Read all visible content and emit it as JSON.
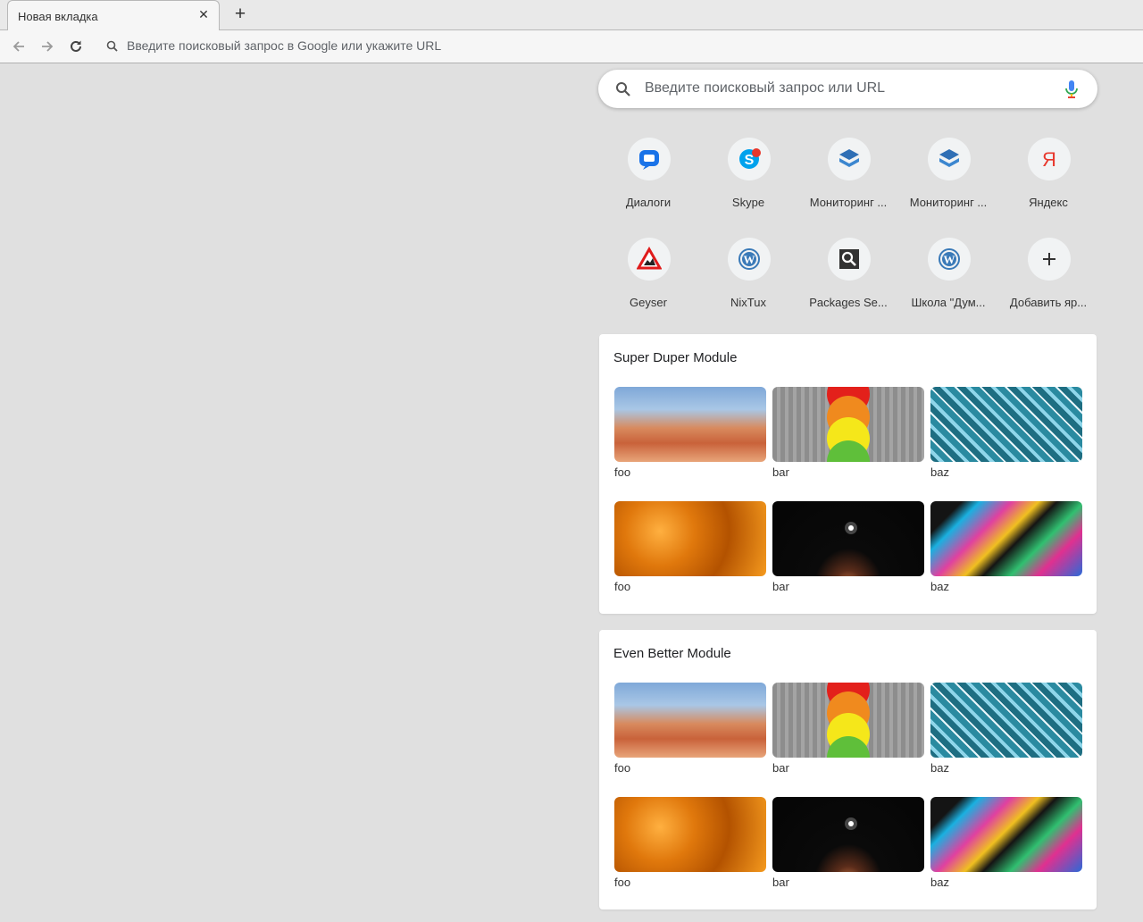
{
  "tab": {
    "title": "Новая вкладка"
  },
  "omnibox": {
    "placeholder": "Введите поисковый запрос в Google или укажите URL"
  },
  "search": {
    "placeholder": "Введите поисковый запрос или URL"
  },
  "shortcuts": [
    {
      "label": "Диалоги",
      "icon": "messages-icon"
    },
    {
      "label": "Skype",
      "icon": "skype-icon"
    },
    {
      "label": "Мониторинг ...",
      "icon": "layers-icon"
    },
    {
      "label": "Мониторинг ...",
      "icon": "layers-icon"
    },
    {
      "label": "Яндекс",
      "icon": "yandex-icon"
    },
    {
      "label": "Geyser",
      "icon": "geyser-icon"
    },
    {
      "label": "NixTux",
      "icon": "wordpress-icon"
    },
    {
      "label": "Packages Se...",
      "icon": "packages-search-icon"
    },
    {
      "label": "Школа \"Дум...",
      "icon": "wordpress-icon"
    },
    {
      "label": "Добавить яр...",
      "icon": "plus-icon"
    }
  ],
  "modules": [
    {
      "title": "Super Duper Module",
      "tiles": [
        {
          "label": "foo",
          "image": "desert-arch"
        },
        {
          "label": "bar",
          "image": "traffic-lights"
        },
        {
          "label": "baz",
          "image": "glass-facade"
        },
        {
          "label": "foo",
          "image": "amber-texture"
        },
        {
          "label": "bar",
          "image": "space-horizon"
        },
        {
          "label": "baz",
          "image": "paint-splash"
        }
      ]
    },
    {
      "title": "Even Better Module",
      "tiles": [
        {
          "label": "foo",
          "image": "desert-arch"
        },
        {
          "label": "bar",
          "image": "traffic-lights"
        },
        {
          "label": "baz",
          "image": "glass-facade"
        },
        {
          "label": "foo",
          "image": "amber-texture"
        },
        {
          "label": "bar",
          "image": "space-horizon"
        },
        {
          "label": "baz",
          "image": "paint-splash"
        }
      ]
    }
  ]
}
